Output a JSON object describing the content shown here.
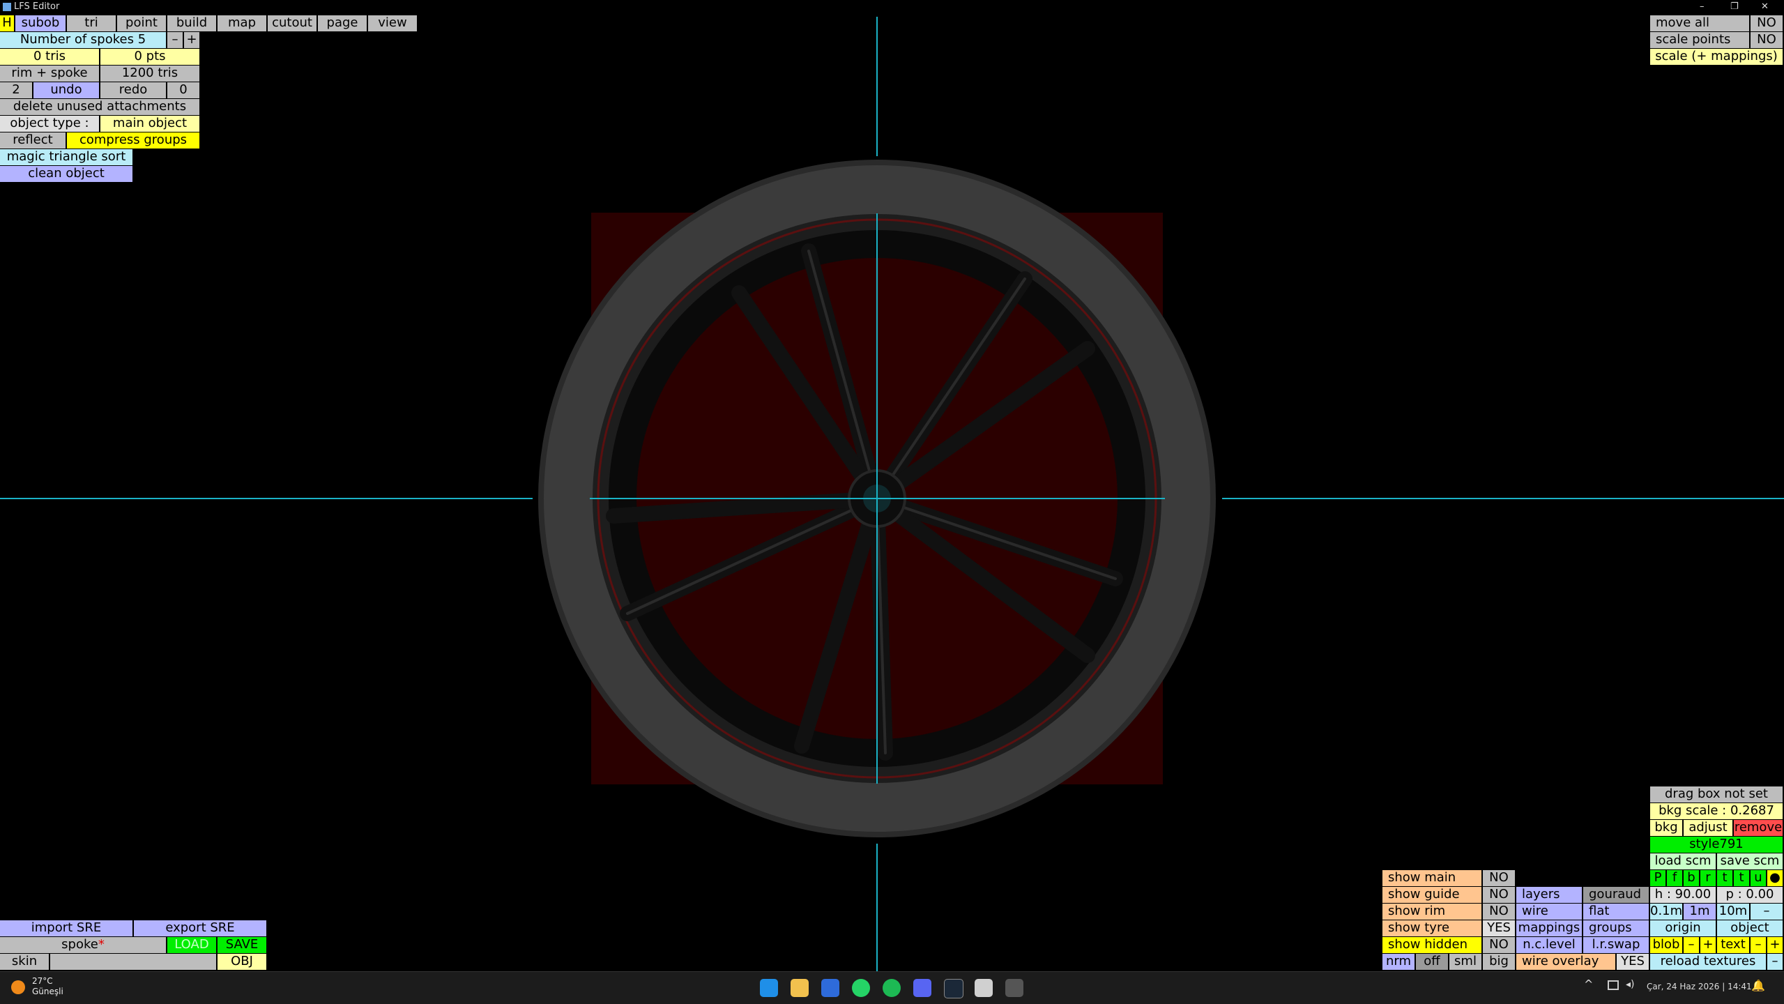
{
  "window": {
    "title": "LFS Editor",
    "minimize": "–",
    "restore": "❐",
    "close": "✕"
  },
  "menu": {
    "h": "H",
    "tabs": [
      "subob",
      "tri",
      "point",
      "build",
      "map",
      "cutout",
      "page",
      "view"
    ]
  },
  "left_panel": {
    "spokes_label": "Number of spokes 5",
    "minus": "–",
    "plus": "+",
    "tris": "0 tris",
    "pts": "0 pts",
    "rim_spoke": "rim + spoke",
    "rim_tris": "1200 tris",
    "undo_count": "2",
    "undo": "undo",
    "redo": "redo",
    "redo_count": "0",
    "delete_unused": "delete unused attachments",
    "object_type_label": "object type :",
    "object_type_value": "main object",
    "reflect": "reflect",
    "compress_groups": "compress groups",
    "magic_sort": "magic triangle sort",
    "clean_object": "clean object"
  },
  "top_right": {
    "move_all": "move all",
    "move_all_val": "NO",
    "scale_points": "scale points",
    "scale_points_val": "NO",
    "scale_mappings": "scale (+ mappings)"
  },
  "bottom_left": {
    "import_sre": "import SRE",
    "export_sre": "export SRE",
    "spoke": "spoke",
    "spoke_marker": "*",
    "load": "LOAD",
    "save": "SAVE",
    "skin": "skin",
    "obj": "OBJ"
  },
  "bottom_right": {
    "drag_box": "drag box not set",
    "bkg_scale": "bkg scale : 0.2687",
    "bkg": "bkg",
    "adjust": "adjust",
    "remove": "remove",
    "style": "style791",
    "load_scm": "load scm",
    "save_scm": "save scm",
    "letters": [
      "P",
      "f",
      "b",
      "r",
      "t",
      "t",
      "u",
      "●"
    ],
    "h": "h : 90.00",
    "p": "p : 0.00",
    "dist": [
      "0.1m",
      "1m",
      "10m",
      "–"
    ],
    "origin": "origin",
    "object": "object",
    "blob": "blob",
    "blob_minus": "–",
    "blob_plus": "+",
    "text": "text",
    "text_minus": "–",
    "text_plus": "+",
    "reload_textures": "reload textures",
    "reload_minus": "–",
    "show_main": "show main",
    "show_main_val": "NO",
    "show_guide": "show guide",
    "show_guide_val": "NO",
    "show_rim": "show rim",
    "show_rim_val": "NO",
    "show_tyre": "show tyre",
    "show_tyre_val": "YES",
    "show_hidden": "show hidden",
    "show_hidden_val": "NO",
    "layers": "layers",
    "gouraud": "gouraud",
    "wire": "wire",
    "flat": "flat",
    "mappings": "mappings",
    "groups": "groups",
    "nc_level": "n.c.level",
    "lr_swap": "l.r.swap",
    "nrm": "nrm",
    "off": "off",
    "sml": "sml",
    "big": "big",
    "wire_overlay": "wire overlay",
    "wire_overlay_val": "YES"
  },
  "taskbar": {
    "weather_temp": "27°C",
    "weather_desc": "Güneşli",
    "datetime": "Çar, 24 Haz 2026 | 14:41",
    "apps": [
      "windows-start",
      "file-explorer",
      "app-blue",
      "whatsapp",
      "spotify",
      "discord",
      "steam",
      "app-gray",
      "app-lfs"
    ]
  }
}
